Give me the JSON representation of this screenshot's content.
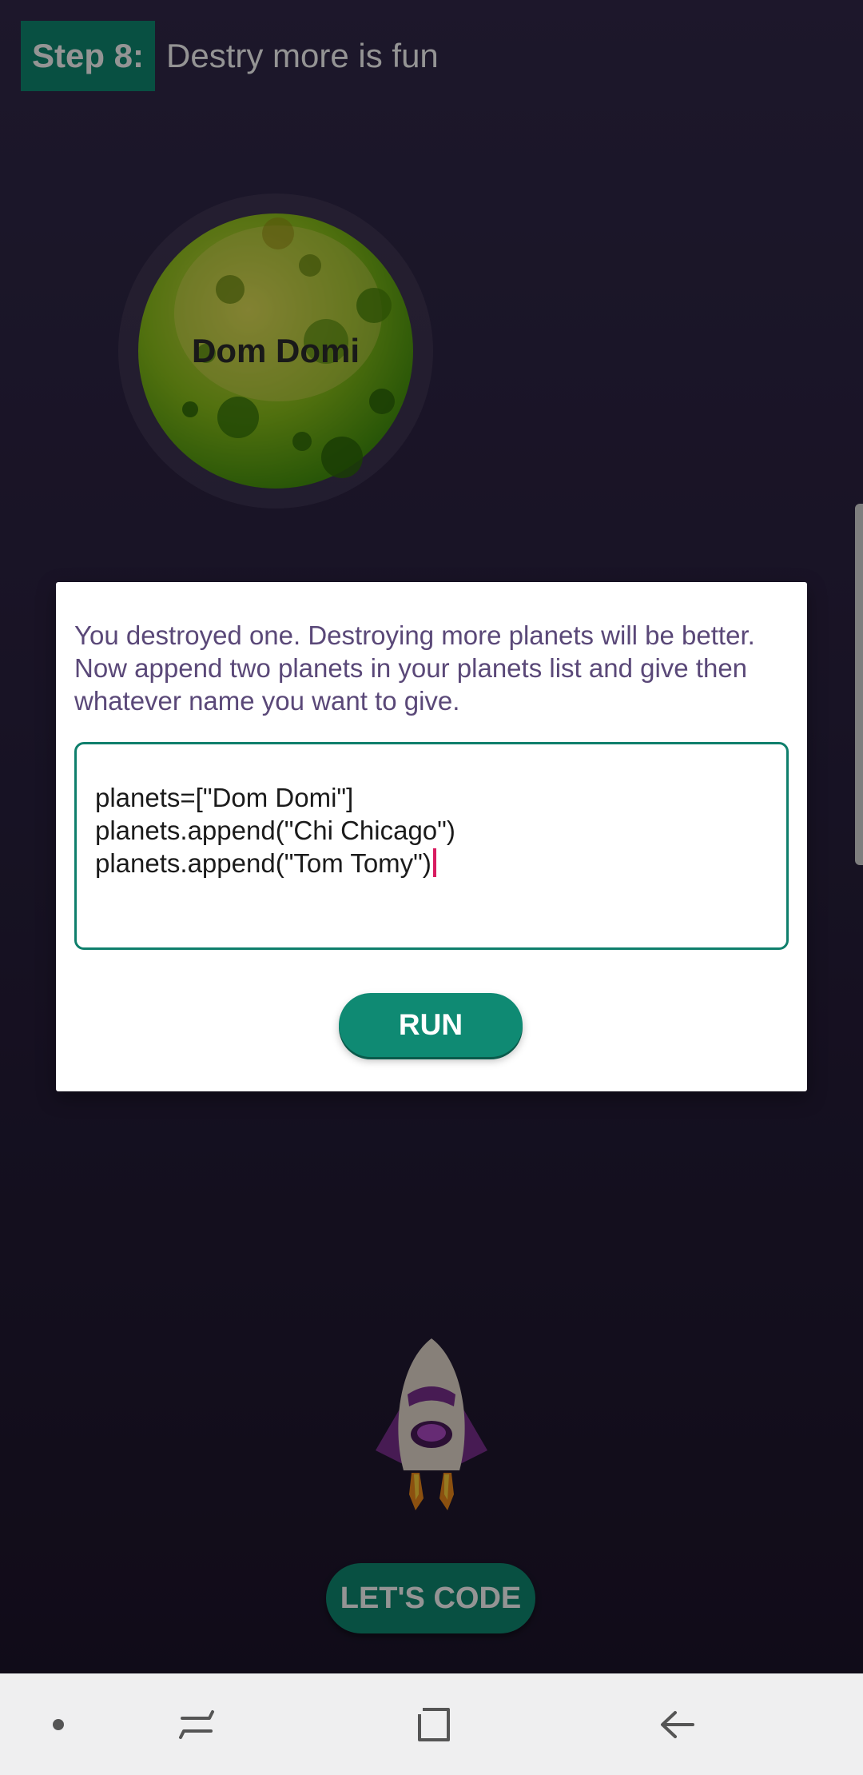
{
  "step": {
    "badge": "Step 8:",
    "title": "Destry more is fun"
  },
  "planet": {
    "name": "Dom Domi"
  },
  "dialog": {
    "message": "You destroyed one. Destroying more planets will be better. Now append two planets in your planets list and give then whatever name you want to give.",
    "code_lines": [
      "planets=[\"Dom Domi\"]",
      "planets.append(\"Chi Chicago\")",
      "planets.append(\"Tom Tomy\")"
    ],
    "run_label": "RUN"
  },
  "lets_code_label": "LET'S CODE",
  "nav_bar": {
    "items": [
      "dot-icon",
      "recents-icon",
      "home-icon",
      "back-icon"
    ]
  },
  "colors": {
    "accent": "#0f8a73",
    "message_text": "#5a4878",
    "cursor": "#d81b60"
  }
}
